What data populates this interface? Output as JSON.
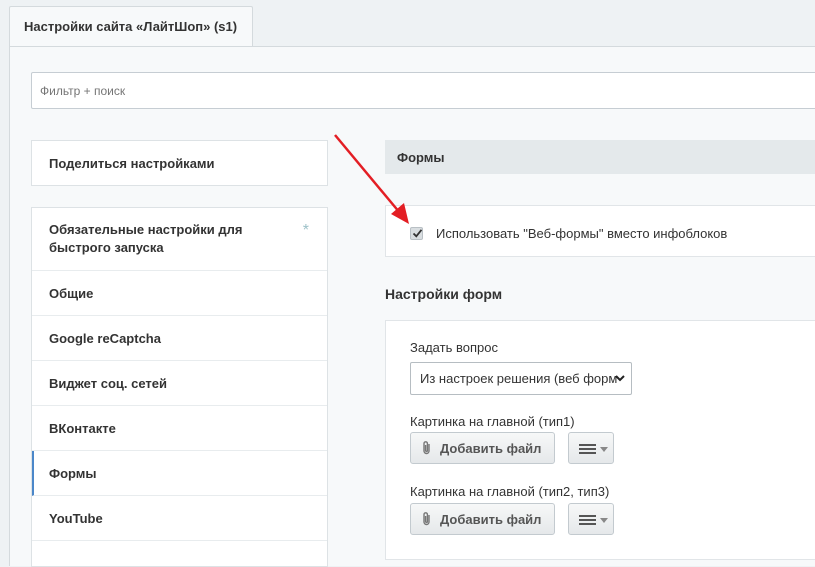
{
  "tab": {
    "title": "Настройки сайта «ЛайтШоп» (s1)"
  },
  "filter": {
    "placeholder": "Фильтр + поиск"
  },
  "share_button": {
    "label": "Поделиться настройками"
  },
  "sidebar": {
    "items": [
      {
        "label": "Обязательные настройки для быстрого запуска",
        "marker": "*"
      },
      {
        "label": "Общие"
      },
      {
        "label": "Google reCaptcha"
      },
      {
        "label": "Виджет соц. сетей"
      },
      {
        "label": "ВКонтакте"
      },
      {
        "label": "Формы",
        "active": true
      },
      {
        "label": "YouTube"
      }
    ]
  },
  "forms_section": {
    "title": "Формы",
    "checkbox": {
      "label": "Использовать \"Веб-формы\" вместо инфоблоков",
      "checked": true
    }
  },
  "form_settings": {
    "title": "Настройки форм",
    "ask_question": {
      "label": "Задать вопрос",
      "selected": "Из настроек решения (веб формы)"
    },
    "image_main_1": {
      "label": "Картинка на главной (тип1)",
      "button": "Добавить файл"
    },
    "image_main_2": {
      "label": "Картинка на главной (тип2, тип3)",
      "button": "Добавить файл"
    }
  },
  "colors": {
    "accent": "#4b87c9",
    "arrow": "#e31e24",
    "section_bg": "#e4e9eb"
  },
  "icons": {
    "paperclip": "paperclip-icon",
    "menu": "menu-icon",
    "chevron": "chevron-down-icon",
    "check": "check-icon",
    "arrow": "annotation-arrow"
  }
}
